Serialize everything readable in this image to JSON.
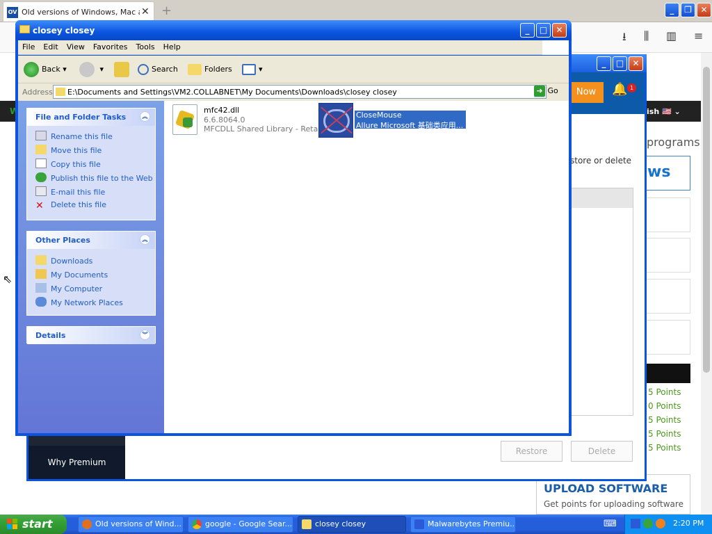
{
  "firefox": {
    "tab_title": "Old versions of Windows, Mac and",
    "tab_favicon": "OV",
    "menu_icon": "≡"
  },
  "website": {
    "language": "ish",
    "programs_heading": "programs",
    "ws_text": "ws",
    "points": [
      "5 Points",
      "0 Points",
      "5 Points",
      "5 Points",
      "5 Points"
    ],
    "upload_title": "UPLOAD SOFTWARE",
    "upload_sub": "Get points for uploading software"
  },
  "malwarebytes": {
    "now_button": "Now",
    "notification_count": "1",
    "store_text": "store or delete",
    "restore_button": "Restore",
    "delete_button": "Delete",
    "why_premium": "Why Premium"
  },
  "explorer": {
    "title": "closey closey",
    "menu": [
      "File",
      "Edit",
      "View",
      "Favorites",
      "Tools",
      "Help"
    ],
    "toolbar": {
      "back": "Back",
      "search": "Search",
      "folders": "Folders"
    },
    "address_label": "Address",
    "address_value": "E:\\Documents and Settings\\VM2.COLLABNET\\My Documents\\Downloads\\closey closey",
    "go_label": "Go",
    "tasks": {
      "header": "File and Folder Tasks",
      "items": [
        "Rename this file",
        "Move this file",
        "Copy this file",
        "Publish this file to the Web",
        "E-mail this file",
        "Delete this file"
      ]
    },
    "places": {
      "header": "Other Places",
      "items": [
        "Downloads",
        "My Documents",
        "My Computer",
        "My Network Places"
      ]
    },
    "details": {
      "header": "Details"
    },
    "files": [
      {
        "name": "mfc42.dll",
        "line2": "6.6.8064.0",
        "line3": "MFCDLL Shared Library - Retai..."
      },
      {
        "name": "CloseMouse",
        "line2": "Allure Microsoft 基础类应用..."
      }
    ]
  },
  "taskbar": {
    "start": "start",
    "items": [
      "Old versions of Wind...",
      "google - Google Sear...",
      "closey closey",
      "Malwarebytes Premiu..."
    ],
    "clock": "2:20 PM"
  }
}
